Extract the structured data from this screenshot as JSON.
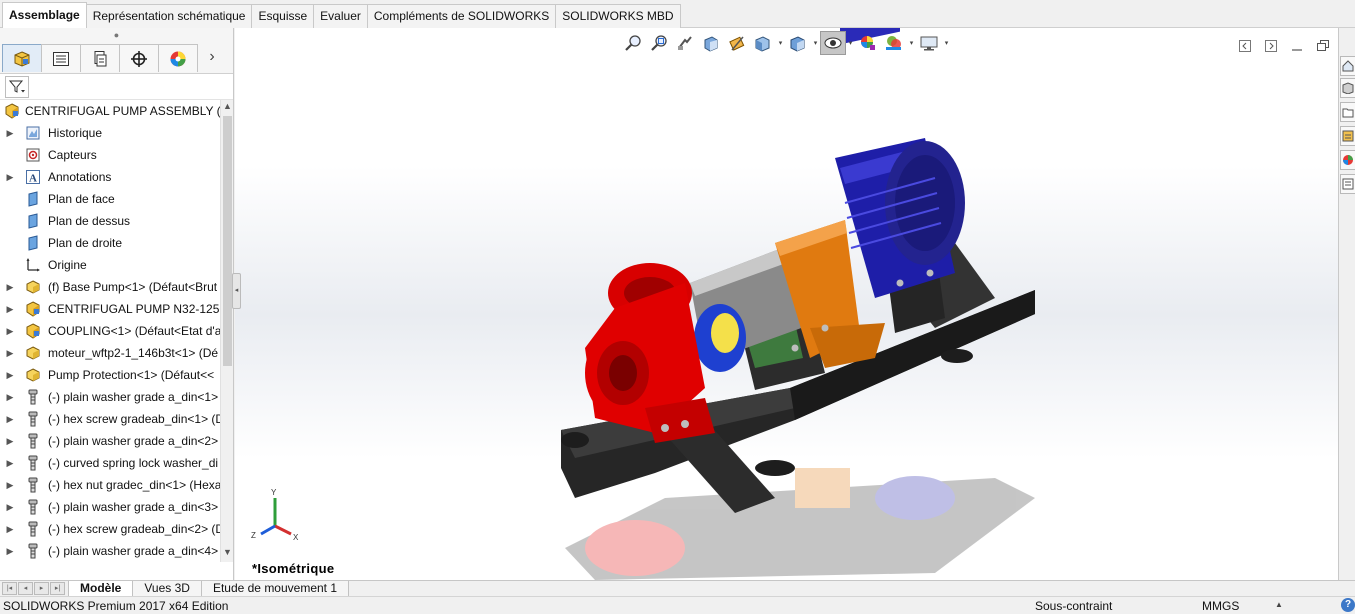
{
  "command_tabs": [
    "Assemblage",
    "Représentation schématique",
    "Esquisse",
    "Evaluer",
    "Compléments de SOLIDWORKS",
    "SOLIDWORKS MBD"
  ],
  "feature_manager": {
    "tab_icons": [
      "feature-tree-icon",
      "property-manager-icon",
      "configuration-manager-icon",
      "dimxpert-icon",
      "display-manager-icon"
    ],
    "more_label": "›",
    "root": {
      "label": "CENTRIFUGAL PUMP ASSEMBLY  (Dé",
      "icon": "assembly-icon"
    },
    "items": [
      {
        "label": "Historique",
        "icon": "history-icon",
        "expandable": true
      },
      {
        "label": "Capteurs",
        "icon": "sensor-icon",
        "expandable": false
      },
      {
        "label": "Annotations",
        "icon": "annotation-icon",
        "expandable": true
      },
      {
        "label": "Plan de face",
        "icon": "plane-icon",
        "expandable": false
      },
      {
        "label": "Plan de dessus",
        "icon": "plane-icon",
        "expandable": false
      },
      {
        "label": "Plan de droite",
        "icon": "plane-icon",
        "expandable": false
      },
      {
        "label": "Origine",
        "icon": "origin-icon",
        "expandable": false
      },
      {
        "label": "(f) Base Pump<1> (Défaut<Brut",
        "icon": "part-icon",
        "expandable": true
      },
      {
        "label": "CENTRIFUGAL PUMP N32-125<1",
        "icon": "subassembly-icon",
        "expandable": true
      },
      {
        "label": "COUPLING<1> (Défaut<Etat d'a",
        "icon": "subassembly-icon",
        "expandable": true
      },
      {
        "label": "moteur_wftp2-1_146b3t<1> (Dé",
        "icon": "part-icon",
        "expandable": true
      },
      {
        "label": "Pump Protection<1> (Défaut<<",
        "icon": "part-icon",
        "expandable": true
      },
      {
        "label": "(-) plain washer grade a_din<1>",
        "icon": "toolbox-part-icon",
        "expandable": true
      },
      {
        "label": "(-) hex screw gradeab_din<1> (D",
        "icon": "toolbox-part-icon",
        "expandable": true
      },
      {
        "label": "(-) plain washer grade a_din<2>",
        "icon": "toolbox-part-icon",
        "expandable": true
      },
      {
        "label": "(-) curved spring lock washer_di",
        "icon": "toolbox-part-icon",
        "expandable": true
      },
      {
        "label": "(-) hex nut gradec_din<1> (Hexa",
        "icon": "toolbox-part-icon",
        "expandable": true
      },
      {
        "label": "(-) plain washer grade a_din<3>",
        "icon": "toolbox-part-icon",
        "expandable": true
      },
      {
        "label": "(-) hex screw gradeab_din<2> (D",
        "icon": "toolbox-part-icon",
        "expandable": true
      },
      {
        "label": "(-) plain washer grade a_din<4>",
        "icon": "toolbox-part-icon",
        "expandable": true
      }
    ]
  },
  "viewport": {
    "view_name": "*Isométrique",
    "triad_labels": {
      "x": "X",
      "y": "Y",
      "z": "Z"
    },
    "heads_up_icons": [
      "zoom-to-fit-icon",
      "zoom-to-area-icon",
      "previous-view-icon",
      "section-view-icon",
      "dynamic-annotation-icon",
      "view-orientation-icon",
      "display-style-icon",
      "hide-show-items-icon",
      "edit-appearance-icon",
      "apply-scene-icon",
      "view-settings-icon"
    ],
    "model_colors": {
      "pump_casing": "#e00000",
      "motor": "#1e1ea8",
      "bracket": "#e07a10",
      "base": "#2a2a2a",
      "bearing_housing": "#8a8a8a"
    }
  },
  "bottom_tabs": [
    "Modèle",
    "Vues 3D",
    "Etude de mouvement 1"
  ],
  "status": {
    "product": "SOLIDWORKS Premium 2017 x64 Edition",
    "state": "Sous-contraint",
    "units": "MMGS",
    "help": "?"
  }
}
